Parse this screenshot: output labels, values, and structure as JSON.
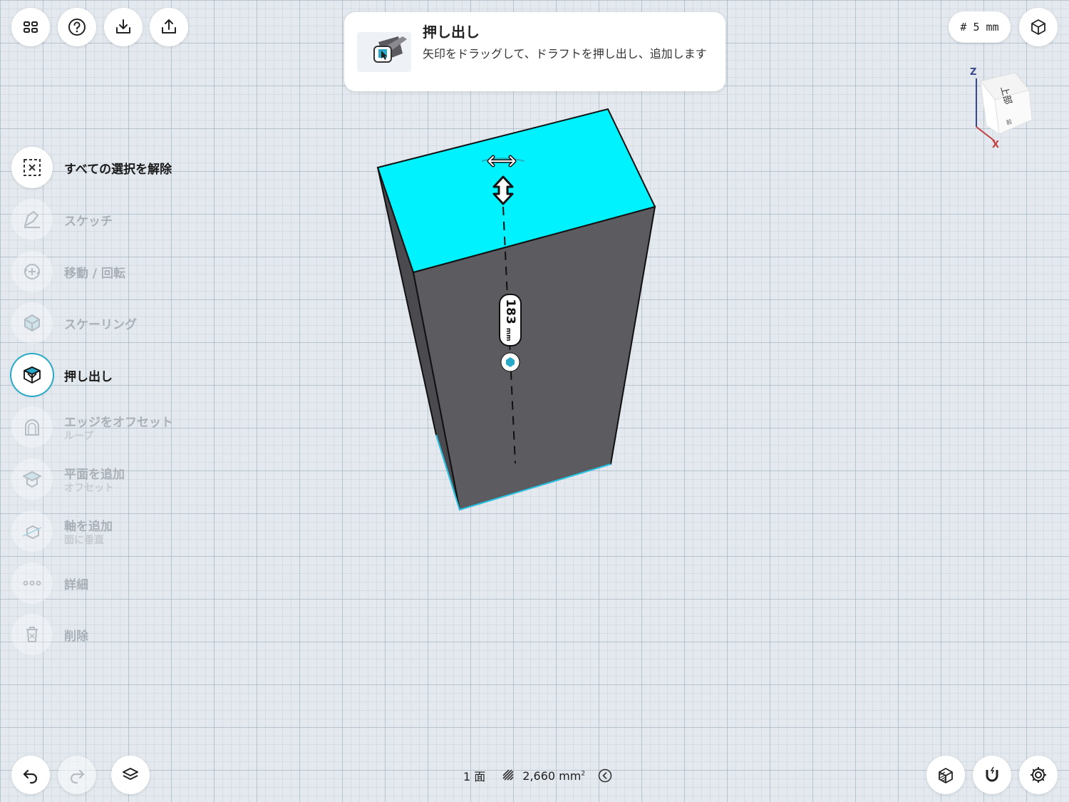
{
  "toolbar_top": {
    "grid_label": "# 5 mm"
  },
  "tooltip": {
    "title": "押し出し",
    "description": "矢印をドラッグして、ドラフトを押し出し、追加します"
  },
  "view_cube": {
    "top_face_label": "上部",
    "front_face_label": "前",
    "axis_z": "Z",
    "axis_x": "X"
  },
  "model": {
    "dimension_value": "183",
    "dimension_unit": "mm",
    "colors": {
      "selected_face": "#00f2ff",
      "body": "#5a5a5f",
      "edge": "#111111"
    }
  },
  "sidebar": {
    "items": [
      {
        "label": "すべての選択を解除",
        "sub": "",
        "icon": "deselect-icon",
        "enabled": true
      },
      {
        "label": "スケッチ",
        "sub": "",
        "icon": "sketch-icon",
        "enabled": false
      },
      {
        "label": "移動 / 回転",
        "sub": "",
        "icon": "move-rotate-icon",
        "enabled": false
      },
      {
        "label": "スケーリング",
        "sub": "",
        "icon": "scale-icon",
        "enabled": false
      },
      {
        "label": "押し出し",
        "sub": "",
        "icon": "extrude-icon",
        "enabled": true,
        "active": true
      },
      {
        "label": "エッジをオフセット",
        "sub": "ループ",
        "icon": "offset-edge-icon",
        "enabled": false
      },
      {
        "label": "平面を追加",
        "sub": "オフセット",
        "icon": "add-plane-icon",
        "enabled": false
      },
      {
        "label": "軸を追加",
        "sub": "面に垂直",
        "icon": "add-axis-icon",
        "enabled": false
      },
      {
        "label": "詳細",
        "sub": "",
        "icon": "more-icon",
        "enabled": false
      },
      {
        "label": "削除",
        "sub": "",
        "icon": "trash-icon",
        "enabled": false
      }
    ]
  },
  "status": {
    "faces": "1 面",
    "area_value": "2,660 mm",
    "area_exp": "2"
  },
  "accent_color": "#27a9c7"
}
